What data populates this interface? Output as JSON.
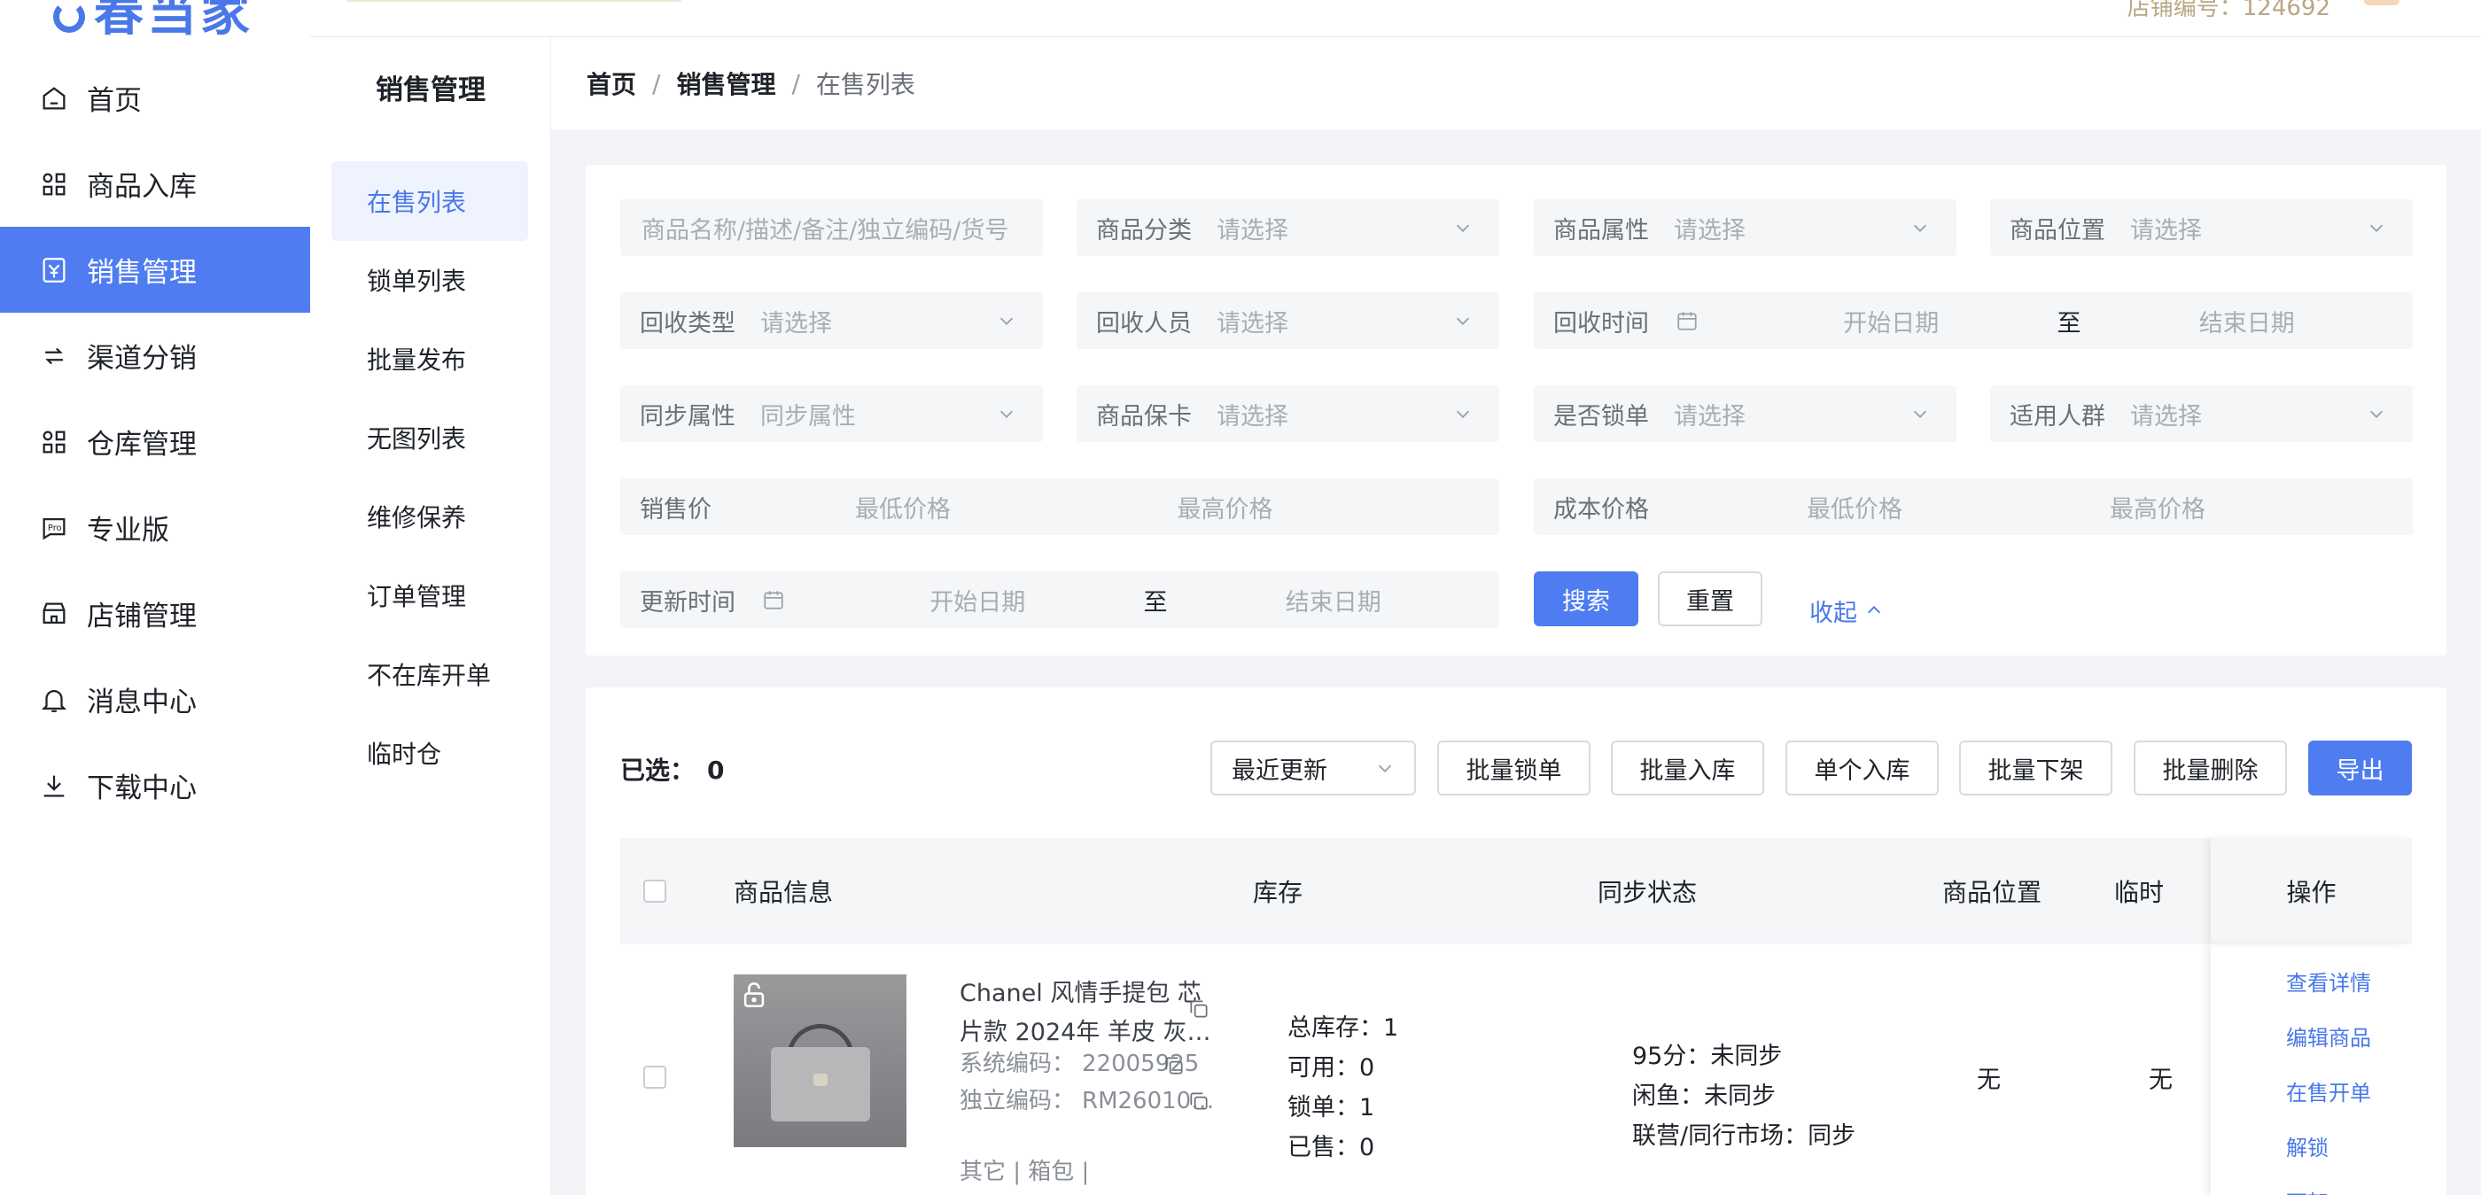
{
  "app": {
    "logo_text": "春当家"
  },
  "header": {
    "store_label": "店铺编号：124692"
  },
  "nav": {
    "items": [
      {
        "label": "首页",
        "icon": "home-icon"
      },
      {
        "label": "商品入库",
        "icon": "grid-icon"
      },
      {
        "label": "销售管理",
        "icon": "sale-icon",
        "active": true
      },
      {
        "label": "渠道分销",
        "icon": "channel-icon"
      },
      {
        "label": "仓库管理",
        "icon": "warehouse-grid-icon"
      },
      {
        "label": "专业版",
        "icon": "pro-icon"
      },
      {
        "label": "店铺管理",
        "icon": "store-icon"
      },
      {
        "label": "消息中心",
        "icon": "bell-icon"
      },
      {
        "label": "下载中心",
        "icon": "download-icon"
      }
    ]
  },
  "subnav": {
    "title": "销售管理",
    "items": [
      {
        "label": "在售列表",
        "active": true
      },
      {
        "label": "锁单列表"
      },
      {
        "label": "批量发布"
      },
      {
        "label": "无图列表"
      },
      {
        "label": "维修保养"
      },
      {
        "label": "订单管理"
      },
      {
        "label": "不在库开单"
      },
      {
        "label": "临时仓"
      }
    ]
  },
  "breadcrumb": {
    "home": "首页",
    "section": "销售管理",
    "current": "在售列表",
    "separator": "/"
  },
  "filters": {
    "keyword_placeholder": "商品名称/描述/备注/独立编码/货号",
    "category": {
      "label": "商品分类",
      "placeholder": "请选择"
    },
    "attribute": {
      "label": "商品属性",
      "placeholder": "请选择"
    },
    "location": {
      "label": "商品位置",
      "placeholder": "请选择"
    },
    "recycle_type": {
      "label": "回收类型",
      "placeholder": "请选择"
    },
    "recycler": {
      "label": "回收人员",
      "placeholder": "请选择"
    },
    "recycle_time": {
      "label": "回收时间",
      "start": "开始日期",
      "to": "至",
      "end": "结束日期"
    },
    "sync_attr": {
      "label": "同步属性",
      "placeholder": "同步属性"
    },
    "warranty": {
      "label": "商品保卡",
      "placeholder": "请选择"
    },
    "locked": {
      "label": "是否锁单",
      "placeholder": "请选择"
    },
    "audience": {
      "label": "适用人群",
      "placeholder": "请选择"
    },
    "sale_price": {
      "label": "销售价",
      "min": "最低价格",
      "max": "最高价格"
    },
    "cost_price": {
      "label": "成本价格",
      "min": "最低价格",
      "max": "最高价格"
    },
    "update_time": {
      "label": "更新时间",
      "start": "开始日期",
      "to": "至",
      "end": "结束日期"
    },
    "search_button": "搜索",
    "reset_button": "重置",
    "collapse_link": "收起"
  },
  "toolbar": {
    "selected_label": "已选：",
    "selected_count": "0",
    "sort_value": "最近更新",
    "buttons": [
      "批量锁单",
      "批量入库",
      "单个入库",
      "批量下架",
      "批量删除"
    ],
    "export_button": "导出"
  },
  "table": {
    "columns": [
      "商品信息",
      "库存",
      "同步状态",
      "商品位置",
      "临时",
      "操作"
    ],
    "rows": [
      {
        "name": "Chanel 风情手提包 芯片款 2024年 羊皮 灰…",
        "sys_code_label": "系统编码：",
        "sys_code": "22005925",
        "ind_code_label": "独立编码：",
        "ind_code": "RM26010…",
        "extra": "其它 | 箱包 |",
        "stock": {
          "total": "总库存：1",
          "available": "可用：0",
          "locked": "锁单：1",
          "sold": "已售：0"
        },
        "sync": {
          "s1": "95分：未同步",
          "s2": "闲鱼：未同步",
          "s3": "联营/同行市场：同步"
        },
        "position": "无",
        "temp": "无",
        "ops": [
          "查看详情",
          "编辑商品",
          "在售开单",
          "解锁",
          "下架"
        ]
      }
    ]
  }
}
